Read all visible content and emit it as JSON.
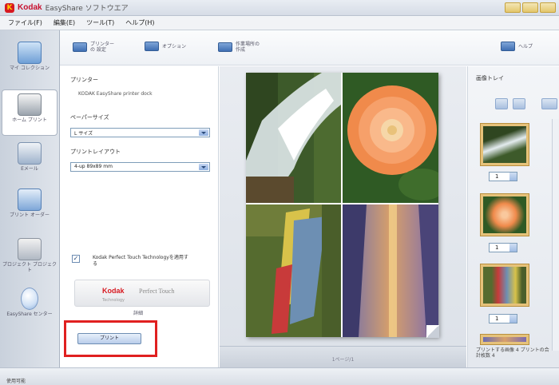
{
  "window": {
    "brand": "Kodak",
    "title": "EasyShare ソフトウエア"
  },
  "menu": [
    "ファイル(F)",
    "編集(E)",
    "ツール(T)",
    "ヘルプ(H)"
  ],
  "nav": [
    {
      "label": "マイ コレクション",
      "icon": "photo-collection-icon"
    },
    {
      "label": "ホーム プリント",
      "icon": "printer-icon"
    },
    {
      "label": "Eメール",
      "icon": "email-icon"
    },
    {
      "label": "プリント オーダー",
      "icon": "print-order-icon"
    },
    {
      "label": "プロジェクト プロジェクト",
      "icon": "project-icon"
    },
    {
      "label": "EasyShare センター",
      "icon": "lightbulb-icon"
    }
  ],
  "toolbar": {
    "printer_settings": "プリンターの 設定",
    "options": "オプション",
    "project": "作業場所の 作成",
    "help": "ヘルプ"
  },
  "left_panel": {
    "printer_label": "プリンター",
    "printer_value": "KODAK EasyShare printer dock",
    "paper_size_label": "ペーパーサイズ",
    "paper_size_value": "L サイズ",
    "layout_label": "プリントレイアウト",
    "layout_value": "4-up 89x89 mm",
    "kpt_checked": true,
    "kpt_text": "Kodak Perfect Touch Technologyを適用する",
    "kpt_logo_brand": "Kodak",
    "kpt_logo_text": "Perfect Touch",
    "kpt_logo_tag": "Technology",
    "detail_link": "詳細",
    "print_button": "プリント"
  },
  "preview": {
    "footer": "1ページ/1"
  },
  "right_panel": {
    "title": "画像トレイ",
    "thumbs": [
      {
        "count": "1"
      },
      {
        "count": "1"
      },
      {
        "count": "1"
      }
    ],
    "note": "プリントする画像 4 プリントの合計枚数 4"
  },
  "status": {
    "text": "使用可能"
  },
  "colors": {
    "accent": "#d71920",
    "highlight": "#e02020"
  }
}
